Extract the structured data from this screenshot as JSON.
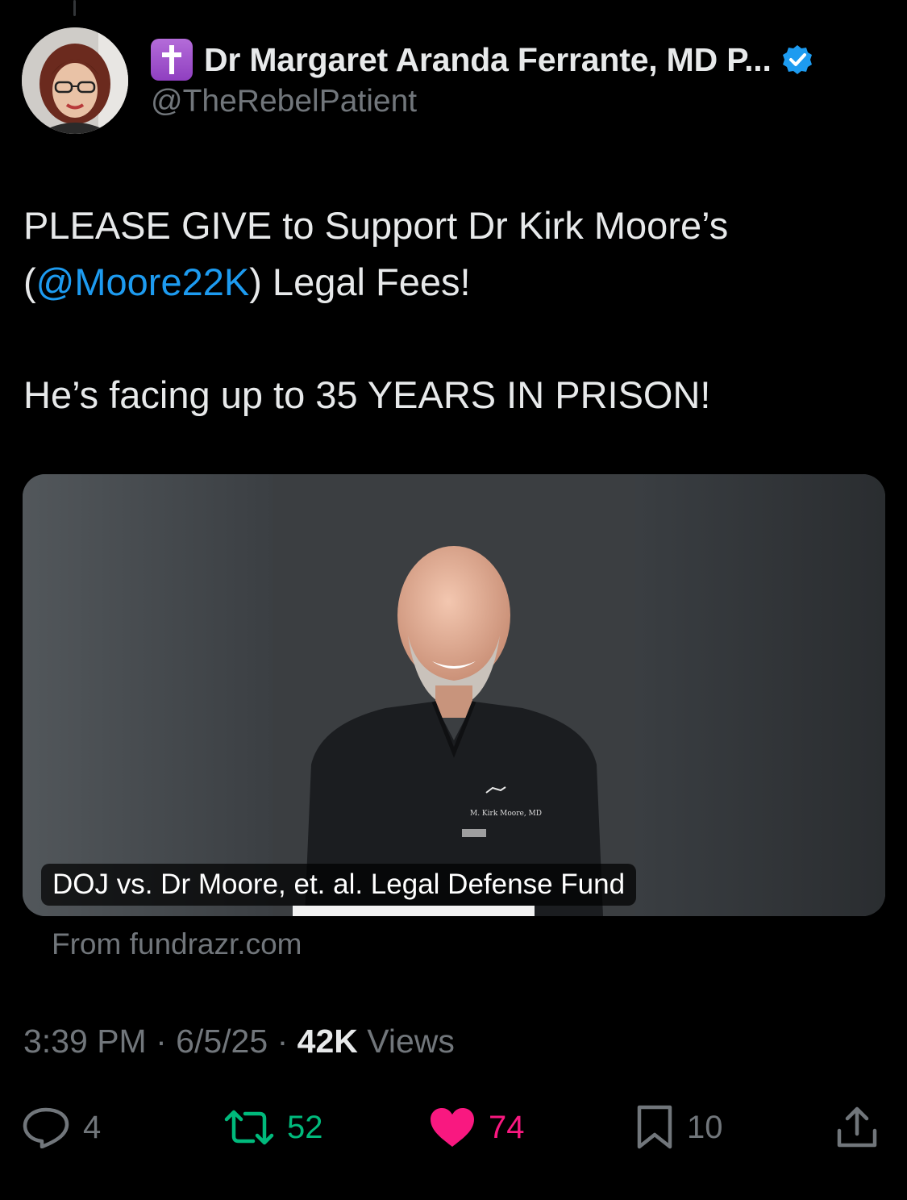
{
  "author": {
    "display_name": "Dr Margaret Aranda Ferrante, MD P...",
    "handle": "@TheRebelPatient",
    "badge_icon": "latin-cross-icon",
    "verified": true,
    "verified_color": "#1d9bf0"
  },
  "tweet": {
    "line1_prefix": "PLEASE GIVE to Support Dr Kirk Moore’s",
    "line2_open_paren": "(",
    "mention": "@Moore22K",
    "line2_suffix": ") Legal Fees!",
    "line3": "He’s facing up to 35 YEARS IN PRISON!"
  },
  "link_card": {
    "caption": "DOJ vs. Dr Moore, et. al. Legal Defense Fund",
    "source": "From fundrazr.com",
    "scrub_name": "M. Kirk Moore, MD"
  },
  "meta": {
    "time": "3:39 PM",
    "separator": "·",
    "date": "6/5/25",
    "views_count": "42K",
    "views_label": "Views"
  },
  "actions": {
    "replies": "4",
    "retweets": "52",
    "likes": "74",
    "bookmarks": "10"
  },
  "colors": {
    "background": "#000000",
    "text": "#e7e9ea",
    "secondary": "#71767b",
    "link": "#1d9bf0",
    "retweet": "#00ba7c",
    "like": "#f91880"
  }
}
